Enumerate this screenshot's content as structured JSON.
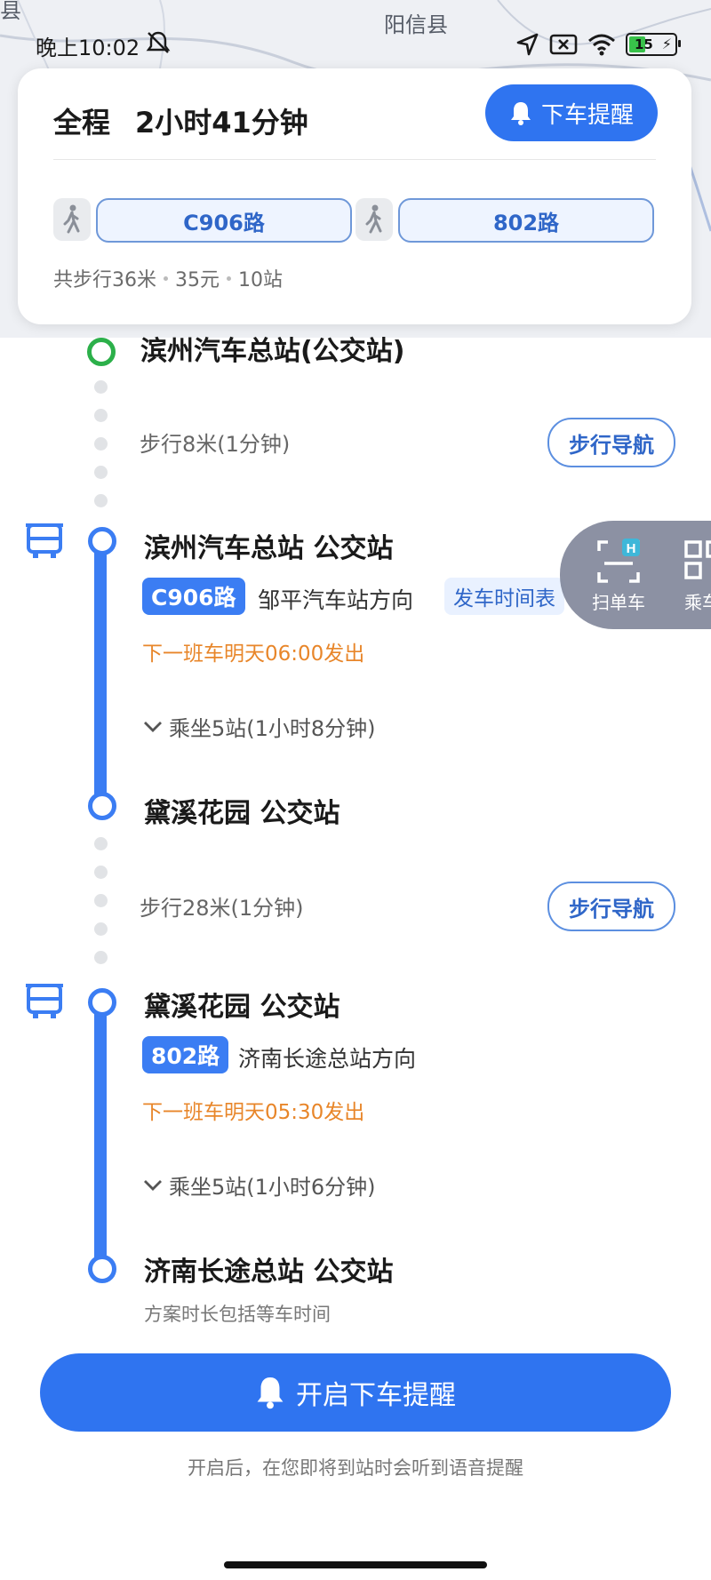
{
  "map": {
    "label_left": "县",
    "label_center": "阳信县"
  },
  "status_bar": {
    "time": "晚上10:02",
    "battery": "15"
  },
  "summary": {
    "total_label": "全程",
    "total_duration": "2小时41分钟",
    "remind_button": "下车提醒",
    "routes": [
      "C906路",
      "802路"
    ],
    "walk_total": "共步行36米",
    "fare": "35元",
    "stops": "10站"
  },
  "segments": {
    "origin": {
      "name": "滨州汽车总站(公交站)"
    },
    "walk1": {
      "text": "步行8米(1分钟)",
      "nav_label": "步行导航"
    },
    "bus1": {
      "board_stop": "滨州汽车总站 公交站",
      "route": "C906路",
      "direction": "邹平汽车站方向",
      "timetable": "发车时间表",
      "next_bus": "下一班车明天06:00发出",
      "ride_info": "乘坐5站(1小时8分钟)",
      "alight_stop": "黛溪花园 公交站"
    },
    "walk2": {
      "text": "步行28米(1分钟)",
      "nav_label": "步行导航"
    },
    "bus2": {
      "board_stop": "黛溪花园 公交站",
      "route": "802路",
      "direction": "济南长途总站方向",
      "next_bus": "下一班车明天05:30发出",
      "ride_info": "乘坐5站(1小时6分钟)",
      "alight_stop": "济南长途总站 公交站"
    }
  },
  "float_panel": {
    "scan_label": "扫单车",
    "ride_label": "乘车"
  },
  "plan_note": "方案时长包括等车时间",
  "main_button": "开启下车提醒",
  "footer_hint": "开启后，在您即将到站时会听到语音提醒",
  "colors": {
    "primary": "#2f74f0",
    "timeline": "#3b7df3",
    "start_ring": "#2cb04a",
    "next_bus": "#e8862a"
  }
}
